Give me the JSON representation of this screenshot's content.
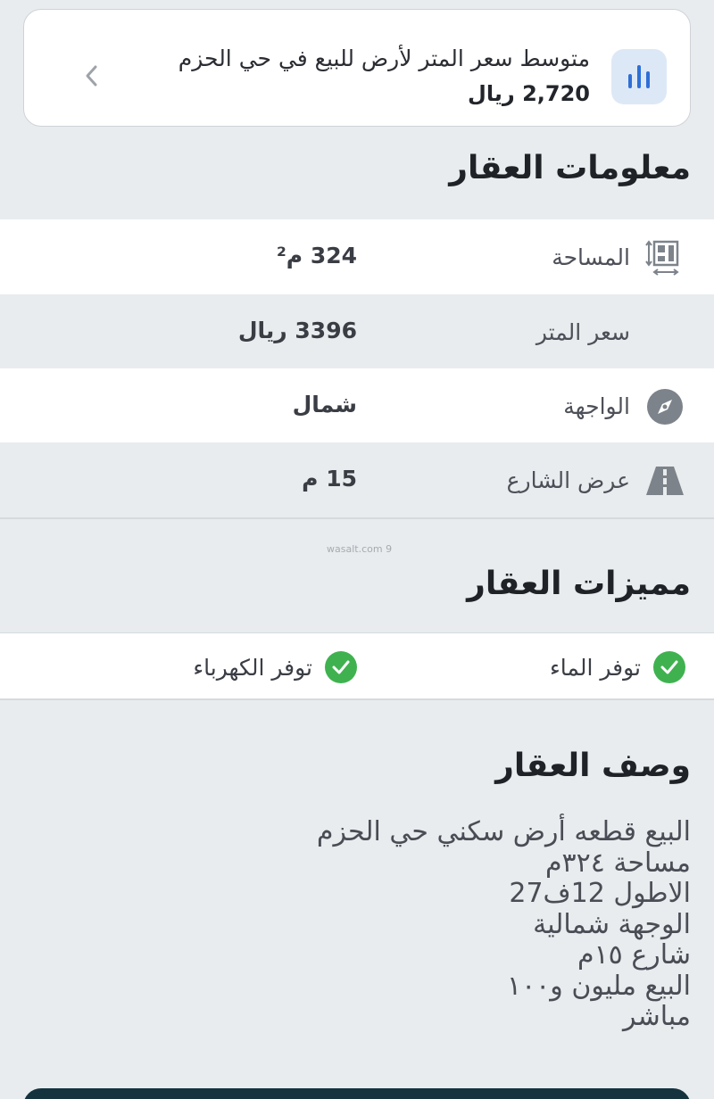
{
  "avg_price": {
    "title": "متوسط سعر المتر لأرض للبيع في حي الحزم",
    "value": "2,720 ريال",
    "icon": "bar-chart-icon",
    "chevron_icon": "chevron-left-icon"
  },
  "property_info": {
    "title": "معلومات العقار",
    "rows": [
      {
        "label": "المساحة",
        "value": "324 م²",
        "icon": "area-icon"
      },
      {
        "label": "سعر المتر",
        "value": "3396 ريال",
        "icon": ""
      },
      {
        "label": "الواجهة",
        "value": "شمال",
        "icon": "compass-icon"
      },
      {
        "label": "عرض الشارع",
        "value": "15 م",
        "icon": "road-icon"
      }
    ]
  },
  "watermark": "wasalt.com 9",
  "features": {
    "title": "مميزات العقار",
    "items": [
      {
        "label": "توفر الماء",
        "icon": "check-circle-icon"
      },
      {
        "label": "توفر الكهرباء",
        "icon": "check-circle-icon"
      }
    ]
  },
  "description": {
    "title": "وصف العقار",
    "lines": [
      "البيع قطعه أرض سكني حي الحزم",
      "مساحة ٣٢٤م",
      "الاطول 12ف27",
      "الوجهة شمالية",
      "شارع ١٥م",
      "البيع مليون و١٠٠",
      "مباشر"
    ]
  },
  "colors": {
    "background": "#e8ecee",
    "card": "#ffffff",
    "accent_blue": "#2f6fd6",
    "icon_box": "#dde8f7",
    "check_green": "#3fb24f",
    "bottom_bar": "#14333e"
  }
}
